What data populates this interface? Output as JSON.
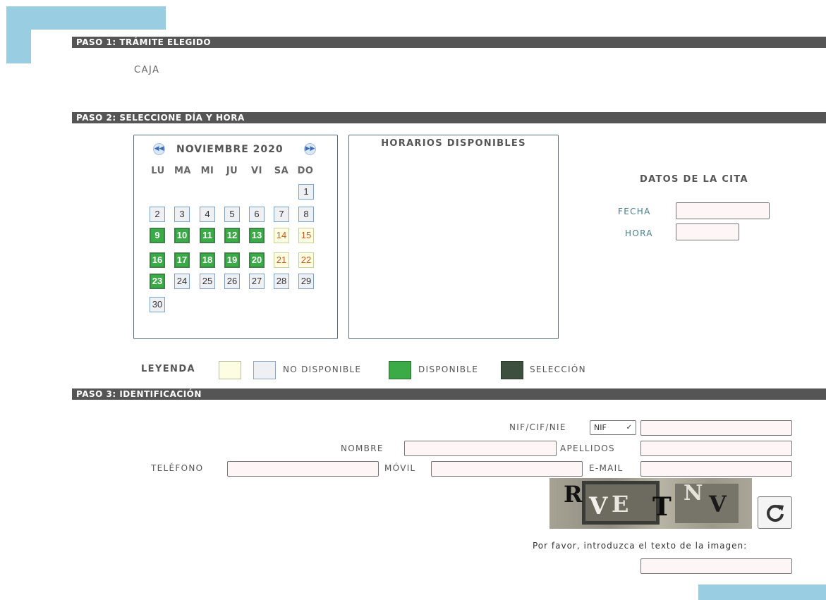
{
  "section1": {
    "title": "PASO 1: TRÁMITE ELEGIDO",
    "tramite": "CAJA"
  },
  "section2": {
    "title": "PASO 2: SELECCIONE DÍA Y HORA",
    "calendar": {
      "month_label": "NOVIEMBRE 2020",
      "prev_icon": "double-chevron-left-icon",
      "next_icon": "double-chevron-right-icon",
      "weekdays": [
        "LU",
        "MA",
        "MI",
        "JU",
        "VI",
        "SA",
        "DO"
      ],
      "days": [
        {
          "n": "1",
          "s": "na"
        },
        {
          "n": "2",
          "s": "na"
        },
        {
          "n": "3",
          "s": "na"
        },
        {
          "n": "4",
          "s": "na"
        },
        {
          "n": "5",
          "s": "na"
        },
        {
          "n": "6",
          "s": "na"
        },
        {
          "n": "7",
          "s": "na"
        },
        {
          "n": "8",
          "s": "na"
        },
        {
          "n": "9",
          "s": "av"
        },
        {
          "n": "10",
          "s": "av"
        },
        {
          "n": "11",
          "s": "av"
        },
        {
          "n": "12",
          "s": "av"
        },
        {
          "n": "13",
          "s": "av"
        },
        {
          "n": "14",
          "s": "wk"
        },
        {
          "n": "15",
          "s": "wk"
        },
        {
          "n": "16",
          "s": "av"
        },
        {
          "n": "17",
          "s": "av"
        },
        {
          "n": "18",
          "s": "av"
        },
        {
          "n": "19",
          "s": "av"
        },
        {
          "n": "20",
          "s": "av"
        },
        {
          "n": "21",
          "s": "wk"
        },
        {
          "n": "22",
          "s": "wk"
        },
        {
          "n": "23",
          "s": "av"
        },
        {
          "n": "24",
          "s": "na"
        },
        {
          "n": "25",
          "s": "na"
        },
        {
          "n": "26",
          "s": "na"
        },
        {
          "n": "27",
          "s": "na"
        },
        {
          "n": "28",
          "s": "na"
        },
        {
          "n": "29",
          "s": "na"
        },
        {
          "n": "30",
          "s": "na"
        }
      ]
    },
    "horarios_title": "HORARIOS DISPONIBLES",
    "datos_title": "DATOS DE LA CITA",
    "fecha_label": "FECHA",
    "fecha_value": "",
    "hora_label": "HORA",
    "hora_value": "",
    "legend": {
      "title": "LEYENDA",
      "items": [
        {
          "label": "",
          "color": "#fdfde4"
        },
        {
          "label": "NO DISPONIBLE",
          "color": "#eef0f3"
        },
        {
          "label": "DISPONIBLE",
          "color": "#3aab46"
        },
        {
          "label": "SELECCIÓN",
          "color": "#3d4f3e"
        }
      ]
    }
  },
  "section3": {
    "title": "PASO 3: IDENTIFICACIÓN",
    "nif_label": "NIF/CIF/NIE",
    "doc_type_selected": "NIF",
    "nif_value": "",
    "nombre_label": "NOMBRE",
    "nombre_value": "",
    "apellidos_label": "APELLIDOS",
    "apellidos_value": "",
    "telefono_label": "TELÉFONO",
    "telefono_value": "",
    "movil_label": "MÓVIL",
    "movil_value": "",
    "email_label": "E-MAIL",
    "email_value": "",
    "captcha_text": "RVETNV",
    "refresh_icon": "refresh-icon",
    "captcha_prompt": "Por favor, introduzca el texto de la imagen:",
    "captcha_value": ""
  },
  "colors": {
    "section_bar": "#555555",
    "accent_deco": "#99cde2",
    "available": "#3aab46",
    "selected": "#3d4f3e",
    "weekend_text": "#cc5a1a"
  }
}
